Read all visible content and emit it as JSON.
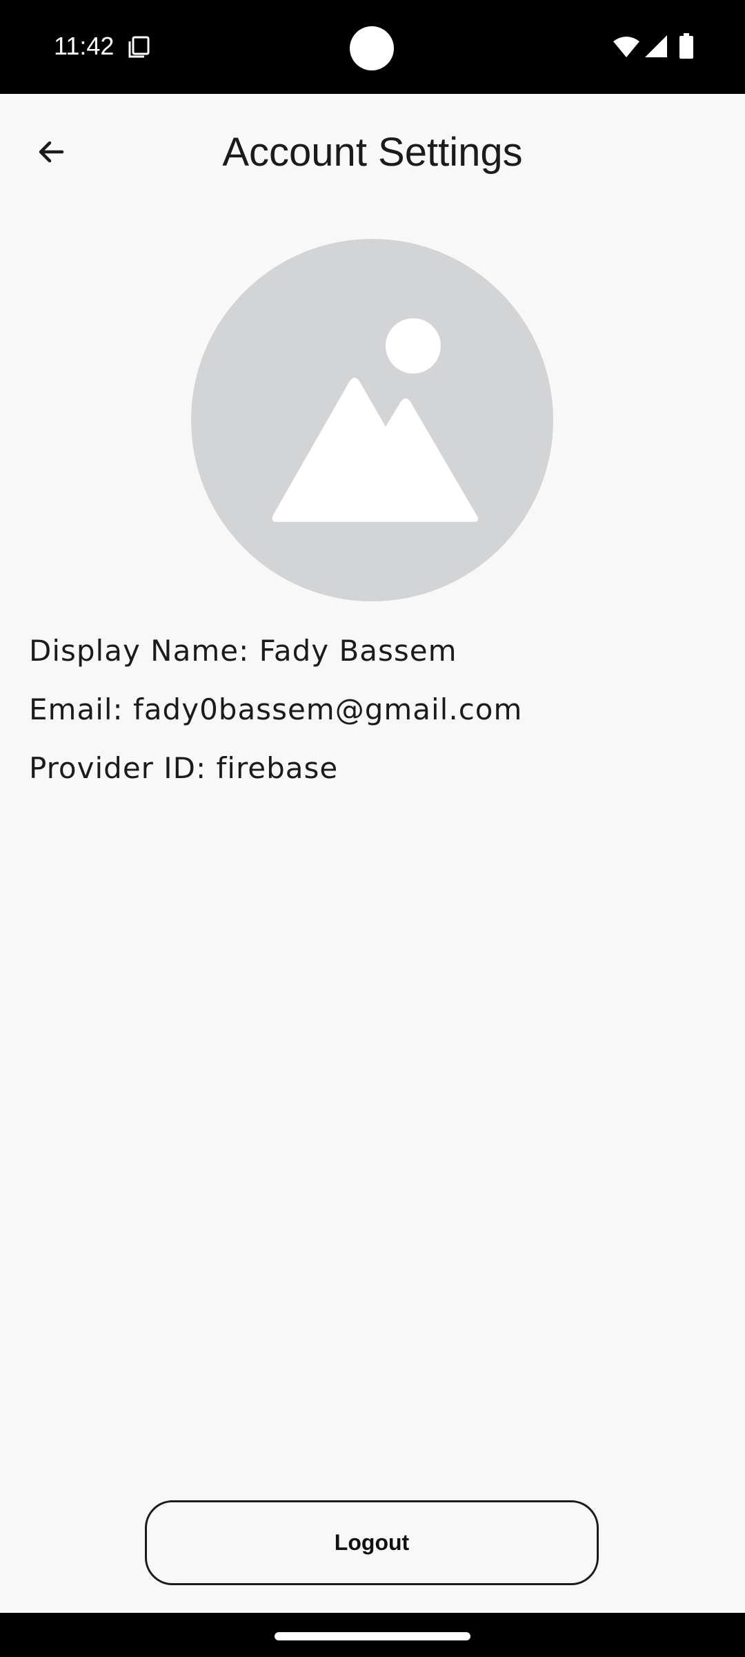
{
  "status_bar": {
    "time": "11:42",
    "icons": [
      "notification-copy-icon",
      "wifi-icon",
      "signal-icon",
      "battery-icon"
    ]
  },
  "header": {
    "title": "Account Settings",
    "back_icon": "arrow-back-icon"
  },
  "profile": {
    "avatar_icon": "image-placeholder-icon",
    "display_name": "Display Name: Fady Bassem",
    "email": "Email: fady0bassem@gmail.com",
    "provider_id": "Provider ID: firebase"
  },
  "actions": {
    "logout_label": "Logout"
  },
  "colors": {
    "background": "#f8f8f8",
    "text": "#1b1b1b",
    "avatar_bg": "#d3d4d6",
    "system_bars": "#000000"
  }
}
